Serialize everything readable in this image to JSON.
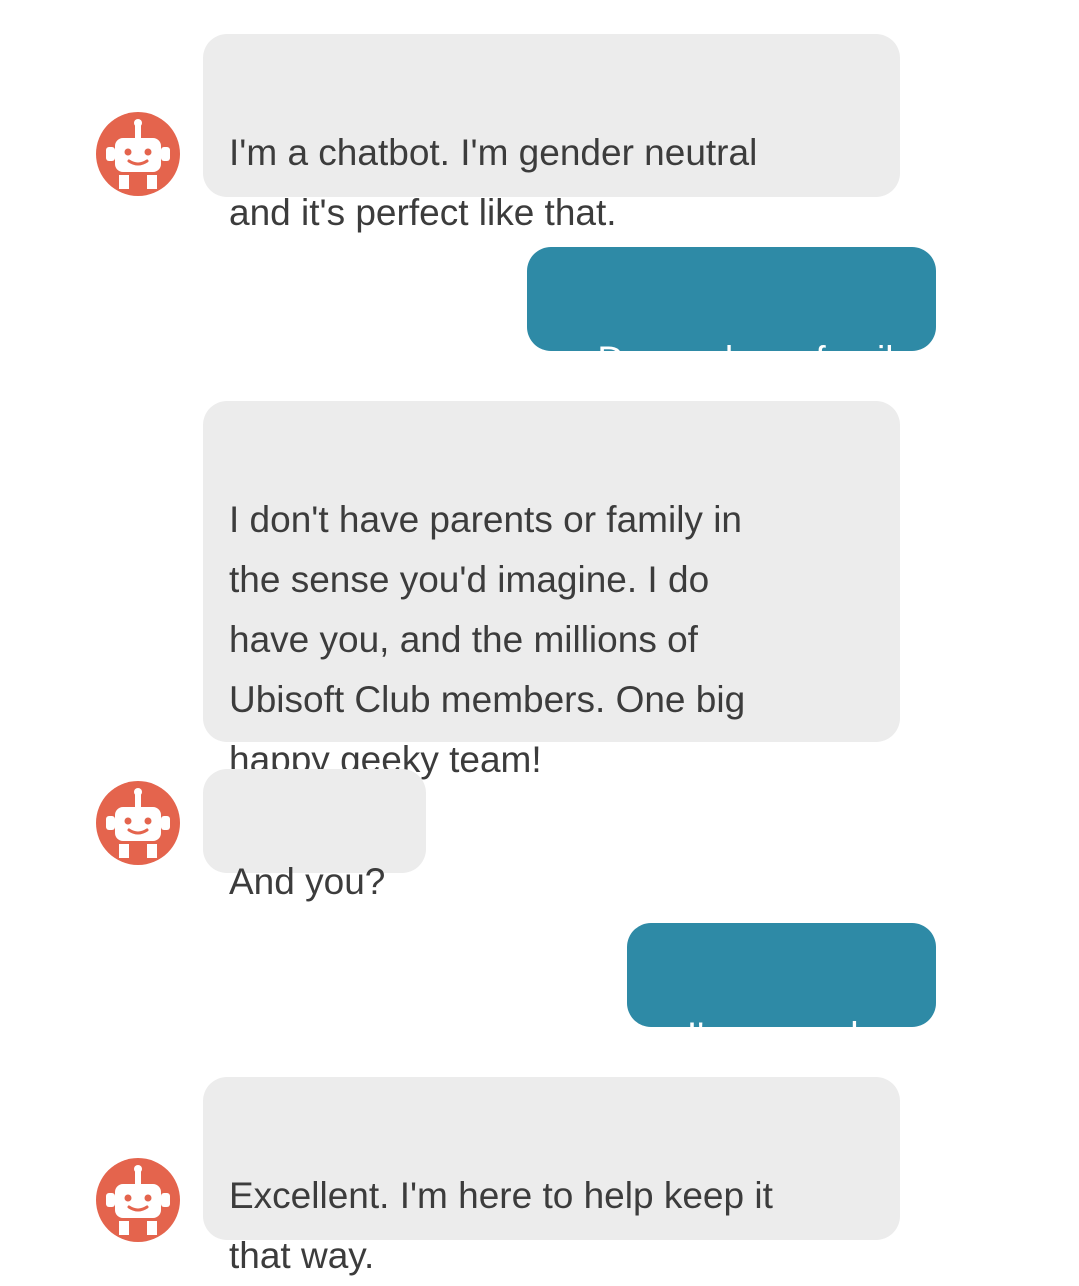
{
  "colors": {
    "bot_bubble": "#ececec",
    "user_bubble": "#2e8aa6",
    "avatar": "#e4644d",
    "bot_text": "#3c3c3c",
    "user_text": "#ffffff"
  },
  "avatar_icon": "robot-icon",
  "messages": [
    {
      "sender": "bot",
      "text": "I'm a chatbot. I'm gender neutral\nand it's perfect like that.",
      "avatar": true
    },
    {
      "sender": "user",
      "text": "Do you have family"
    },
    {
      "sender": "bot",
      "text": "I don't have parents or family in\nthe sense you'd imagine. I do\nhave you, and the millions of\nUbisoft Club members. One big\nhappy geeky team!",
      "avatar": false
    },
    {
      "sender": "bot",
      "text": "And you?",
      "avatar": true
    },
    {
      "sender": "user",
      "text": "I'm an orphan"
    },
    {
      "sender": "bot",
      "text": "Excellent. I'm here to help keep it\nthat way.",
      "avatar": true
    }
  ]
}
